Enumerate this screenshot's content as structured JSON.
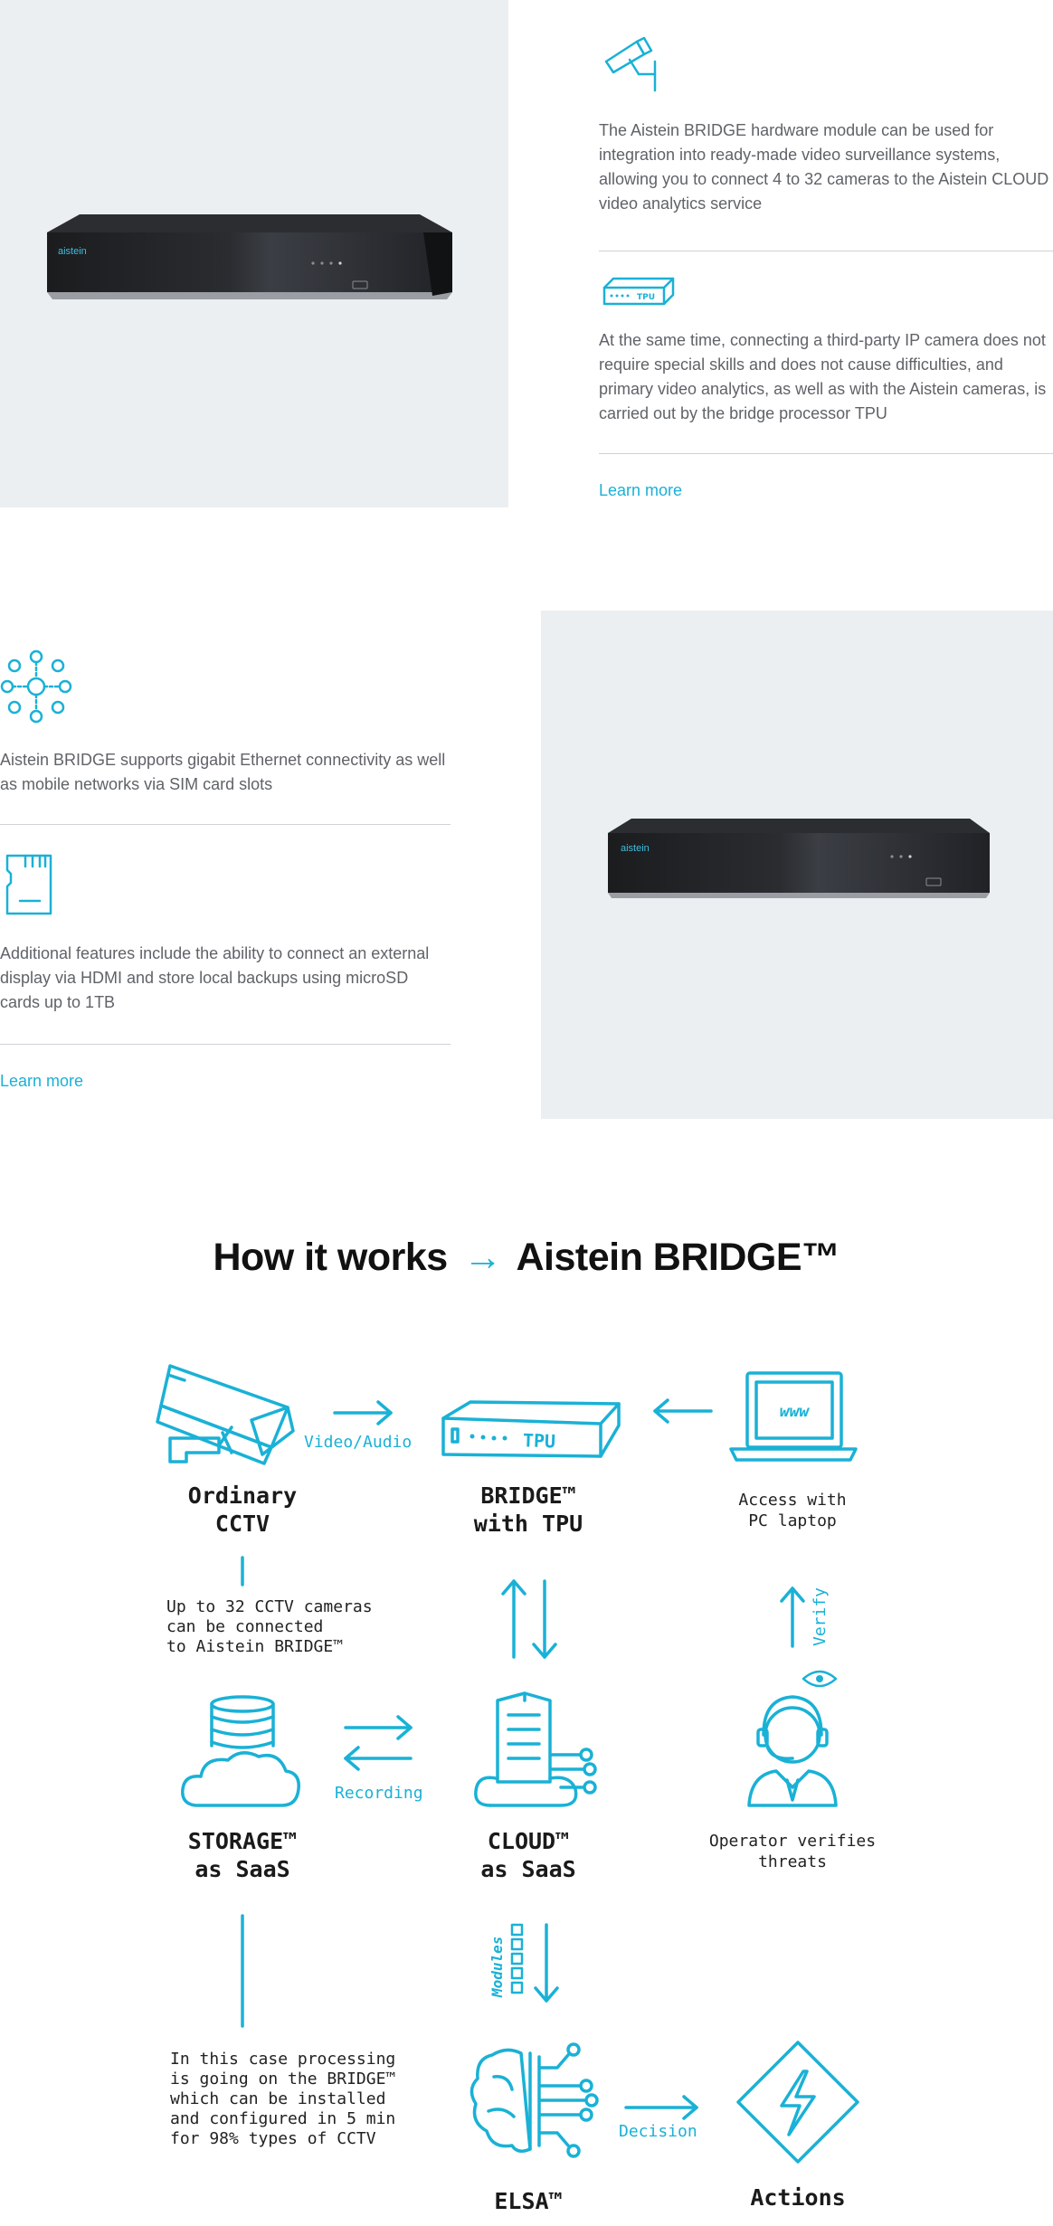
{
  "section1": {
    "feature1_text": "The Aistein BRIDGE hardware module can be used for integration into ready-made video surveillance systems, allowing you to connect 4 to 32 cameras to the Aistein CLOUD video analytics service",
    "feature2_text": "At the same time, connecting a third-party IP camera does not require special skills and does not cause difficulties, and primary video analytics, as well as with the Aistein cameras, is carried out by the bridge processor TPU",
    "learn_more": "Learn more",
    "device_brand": "aistein"
  },
  "section2": {
    "feature1_text": "Aistein BRIDGE supports gigabit Ethernet connectivity as well as mobile networks via SIM card slots",
    "feature2_text": "Additional features include the ability to connect an external display via HDMI and store local backups using microSD cards up to 1TB",
    "learn_more": "Learn more",
    "device_brand": "aistein"
  },
  "how_it_works": {
    "title_left": "How it works",
    "title_arrow": "→",
    "title_right": "Aistein BRIDGE™",
    "nodes": {
      "cctv": "Ordinary\nCCTV",
      "bridge": "BRIDGE™\nwith TPU",
      "laptop": "Access with\nPC laptop",
      "storage": "STORAGE™\nas SaaS",
      "cloud": "CLOUD™\nas SaaS",
      "operator": "Operator verifies\nthreats",
      "elsa": "ELSA™",
      "actions": "Actions"
    },
    "edges": {
      "video_audio": "Video/Audio",
      "recording": "Recording",
      "verify": "Verify",
      "modules": "Modules",
      "decision": "Decision"
    },
    "notes": {
      "cctv_note": "Up to 32 CCTV cameras\ncan be connected\nto Aistein BRIDGE™",
      "storage_note": "In this case processing\nis going on the BRIDGE™\nwhich can be installed\nand configured in 5 min\nfor 98% types of CCTV"
    },
    "laptop_screen_text": "www",
    "tpu_text": "TPU",
    "accent_color": "#1ab1d6"
  }
}
